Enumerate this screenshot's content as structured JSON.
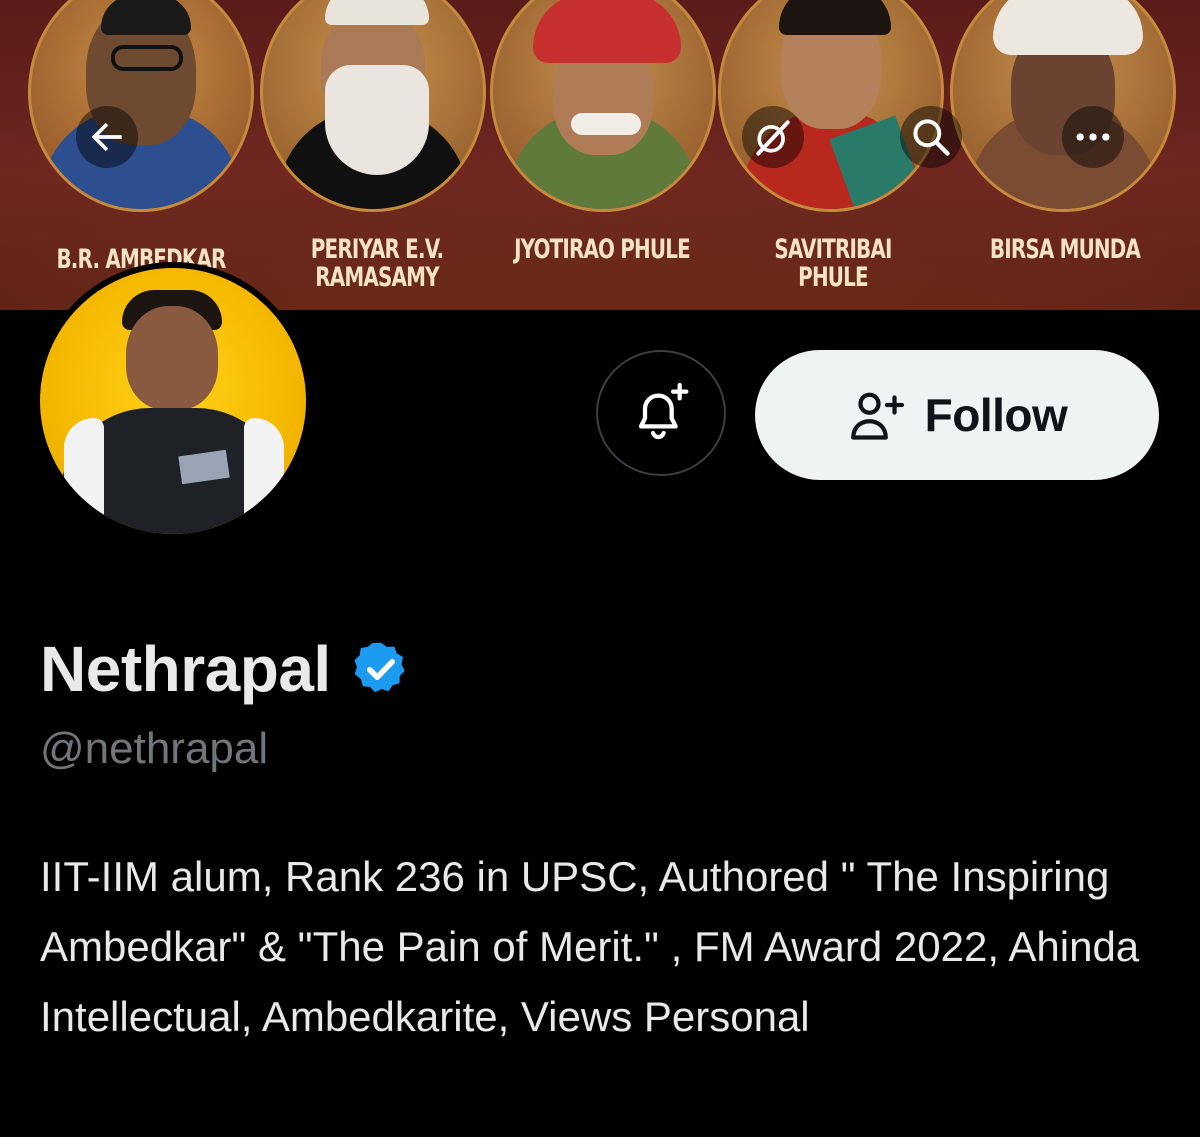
{
  "banner": {
    "portraits": [
      {
        "label": "B.R. AMBEDKAR"
      },
      {
        "label": "PERIYAR E.V. RAMASAMY"
      },
      {
        "label": "JYOTIRAO PHULE"
      },
      {
        "label": "SAVITRIBAI PHULE"
      },
      {
        "label": "BIRSA MUNDA"
      }
    ]
  },
  "nav": {
    "back_icon": "arrow-left-icon",
    "grok_icon": "grok-icon",
    "search_icon": "search-icon",
    "more_icon": "more-dots-icon"
  },
  "actions": {
    "notify_icon": "bell-plus-icon",
    "follow_icon": "person-plus-icon",
    "follow_label": "Follow"
  },
  "profile": {
    "display_name": "Nethrapal",
    "verified_icon": "verified-badge-icon",
    "handle": "@nethrapal",
    "bio": "IIT-IIM alum, Rank 236 in UPSC, Authored \" The Inspiring Ambedkar\" & \"The Pain of Merit.\" , FM Award 2022,  Ahinda Intellectual, Ambedkarite, Views Personal"
  },
  "colors": {
    "background": "#000000",
    "text_primary": "#e7e9ea",
    "text_secondary": "#71767b",
    "verified_blue": "#1d9bf0",
    "follow_button_bg": "#eff3f4"
  }
}
